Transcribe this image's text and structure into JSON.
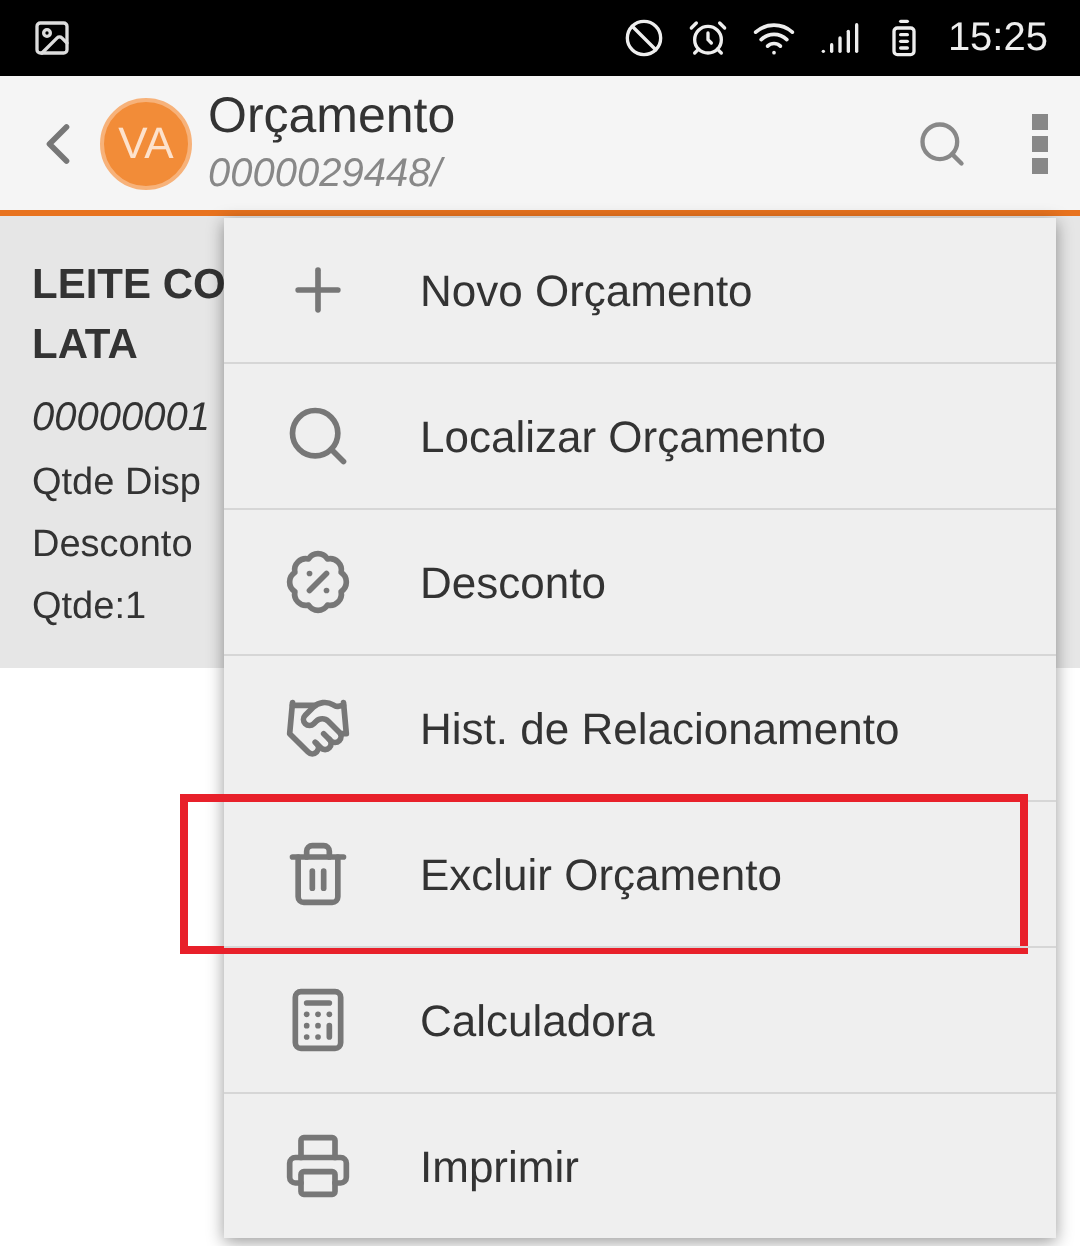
{
  "status_bar": {
    "time": "15:25"
  },
  "app_bar": {
    "avatar": "VA",
    "title": "Orçamento",
    "subtitle": "0000029448/"
  },
  "card": {
    "title_lines": [
      "LEITE CO",
      "LATA"
    ],
    "code": "00000001",
    "lines": [
      "Qtde Disp",
      "Desconto",
      "Qtde:1"
    ]
  },
  "menu": [
    {
      "label": "Novo Orçamento",
      "highlighted": false
    },
    {
      "label": "Localizar Orçamento",
      "highlighted": false
    },
    {
      "label": "Desconto",
      "highlighted": false
    },
    {
      "label": "Hist. de Relacionamento",
      "highlighted": false
    },
    {
      "label": "Excluir Orçamento",
      "highlighted": true
    },
    {
      "label": "Calculadora",
      "highlighted": false
    },
    {
      "label": "Imprimir",
      "highlighted": false
    }
  ]
}
